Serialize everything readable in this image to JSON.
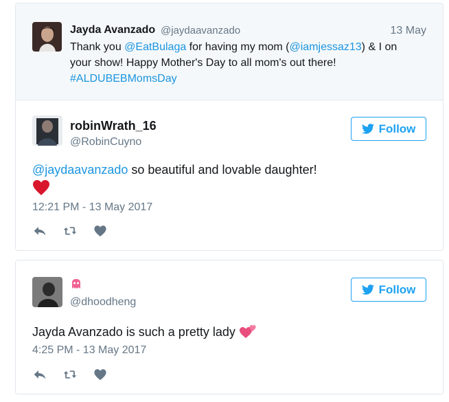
{
  "quoted_tweet": {
    "name": "Jayda Avanzado",
    "handle": "@jaydaavanzado",
    "date": "13 May",
    "text_part1": "Thank you ",
    "mention1": "@EatBulaga",
    "text_part2": " for having my mom (",
    "mention2": "@iamjessaz13",
    "text_part3": ") & I on your show! Happy Mother's Day to all mom's out there! ",
    "hashtag": "#ALDUBEBMomsDay"
  },
  "reply1": {
    "name": "robinWrath_16",
    "handle": "@RobinCuyno",
    "follow_label": "Follow",
    "mention": "@jaydaavanzado",
    "text": " so beautiful and lovable daughter!",
    "emoji": "red-heart-emoji",
    "timestamp": "12:21 PM - 13 May 2017"
  },
  "reply2": {
    "name_emoji": "alien-monster-emoji",
    "handle": "@dhoodheng",
    "follow_label": "Follow",
    "text": "Jayda Avanzado is such a pretty lady ",
    "emoji": "two-hearts-emoji",
    "timestamp": "4:25 PM - 13 May 2017"
  },
  "icons": {
    "reply": "reply-icon",
    "retweet": "retweet-icon",
    "like": "heart-icon",
    "twitter": "twitter-bird-icon"
  },
  "colors": {
    "link": "#1b95e0",
    "follow": "#1da1f2",
    "muted": "#657786",
    "quoted_bg": "#f5f8fa",
    "heart": "#e0245e"
  }
}
